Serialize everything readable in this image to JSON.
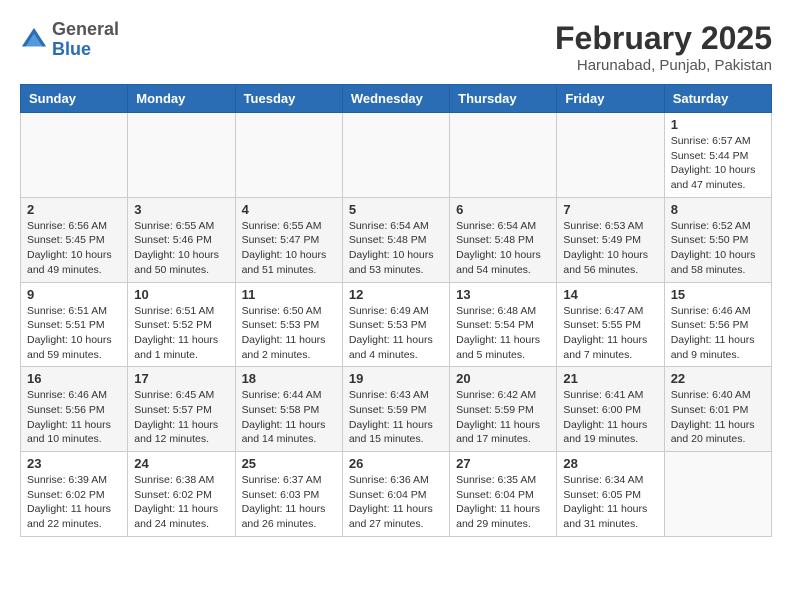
{
  "header": {
    "logo_general": "General",
    "logo_blue": "Blue",
    "month_year": "February 2025",
    "location": "Harunabad, Punjab, Pakistan"
  },
  "days_of_week": [
    "Sunday",
    "Monday",
    "Tuesday",
    "Wednesday",
    "Thursday",
    "Friday",
    "Saturday"
  ],
  "weeks": [
    [
      {
        "day": "",
        "info": ""
      },
      {
        "day": "",
        "info": ""
      },
      {
        "day": "",
        "info": ""
      },
      {
        "day": "",
        "info": ""
      },
      {
        "day": "",
        "info": ""
      },
      {
        "day": "",
        "info": ""
      },
      {
        "day": "1",
        "info": "Sunrise: 6:57 AM\nSunset: 5:44 PM\nDaylight: 10 hours and 47 minutes."
      }
    ],
    [
      {
        "day": "2",
        "info": "Sunrise: 6:56 AM\nSunset: 5:45 PM\nDaylight: 10 hours and 49 minutes."
      },
      {
        "day": "3",
        "info": "Sunrise: 6:55 AM\nSunset: 5:46 PM\nDaylight: 10 hours and 50 minutes."
      },
      {
        "day": "4",
        "info": "Sunrise: 6:55 AM\nSunset: 5:47 PM\nDaylight: 10 hours and 51 minutes."
      },
      {
        "day": "5",
        "info": "Sunrise: 6:54 AM\nSunset: 5:48 PM\nDaylight: 10 hours and 53 minutes."
      },
      {
        "day": "6",
        "info": "Sunrise: 6:54 AM\nSunset: 5:48 PM\nDaylight: 10 hours and 54 minutes."
      },
      {
        "day": "7",
        "info": "Sunrise: 6:53 AM\nSunset: 5:49 PM\nDaylight: 10 hours and 56 minutes."
      },
      {
        "day": "8",
        "info": "Sunrise: 6:52 AM\nSunset: 5:50 PM\nDaylight: 10 hours and 58 minutes."
      }
    ],
    [
      {
        "day": "9",
        "info": "Sunrise: 6:51 AM\nSunset: 5:51 PM\nDaylight: 10 hours and 59 minutes."
      },
      {
        "day": "10",
        "info": "Sunrise: 6:51 AM\nSunset: 5:52 PM\nDaylight: 11 hours and 1 minute."
      },
      {
        "day": "11",
        "info": "Sunrise: 6:50 AM\nSunset: 5:53 PM\nDaylight: 11 hours and 2 minutes."
      },
      {
        "day": "12",
        "info": "Sunrise: 6:49 AM\nSunset: 5:53 PM\nDaylight: 11 hours and 4 minutes."
      },
      {
        "day": "13",
        "info": "Sunrise: 6:48 AM\nSunset: 5:54 PM\nDaylight: 11 hours and 5 minutes."
      },
      {
        "day": "14",
        "info": "Sunrise: 6:47 AM\nSunset: 5:55 PM\nDaylight: 11 hours and 7 minutes."
      },
      {
        "day": "15",
        "info": "Sunrise: 6:46 AM\nSunset: 5:56 PM\nDaylight: 11 hours and 9 minutes."
      }
    ],
    [
      {
        "day": "16",
        "info": "Sunrise: 6:46 AM\nSunset: 5:56 PM\nDaylight: 11 hours and 10 minutes."
      },
      {
        "day": "17",
        "info": "Sunrise: 6:45 AM\nSunset: 5:57 PM\nDaylight: 11 hours and 12 minutes."
      },
      {
        "day": "18",
        "info": "Sunrise: 6:44 AM\nSunset: 5:58 PM\nDaylight: 11 hours and 14 minutes."
      },
      {
        "day": "19",
        "info": "Sunrise: 6:43 AM\nSunset: 5:59 PM\nDaylight: 11 hours and 15 minutes."
      },
      {
        "day": "20",
        "info": "Sunrise: 6:42 AM\nSunset: 5:59 PM\nDaylight: 11 hours and 17 minutes."
      },
      {
        "day": "21",
        "info": "Sunrise: 6:41 AM\nSunset: 6:00 PM\nDaylight: 11 hours and 19 minutes."
      },
      {
        "day": "22",
        "info": "Sunrise: 6:40 AM\nSunset: 6:01 PM\nDaylight: 11 hours and 20 minutes."
      }
    ],
    [
      {
        "day": "23",
        "info": "Sunrise: 6:39 AM\nSunset: 6:02 PM\nDaylight: 11 hours and 22 minutes."
      },
      {
        "day": "24",
        "info": "Sunrise: 6:38 AM\nSunset: 6:02 PM\nDaylight: 11 hours and 24 minutes."
      },
      {
        "day": "25",
        "info": "Sunrise: 6:37 AM\nSunset: 6:03 PM\nDaylight: 11 hours and 26 minutes."
      },
      {
        "day": "26",
        "info": "Sunrise: 6:36 AM\nSunset: 6:04 PM\nDaylight: 11 hours and 27 minutes."
      },
      {
        "day": "27",
        "info": "Sunrise: 6:35 AM\nSunset: 6:04 PM\nDaylight: 11 hours and 29 minutes."
      },
      {
        "day": "28",
        "info": "Sunrise: 6:34 AM\nSunset: 6:05 PM\nDaylight: 11 hours and 31 minutes."
      },
      {
        "day": "",
        "info": ""
      }
    ]
  ]
}
